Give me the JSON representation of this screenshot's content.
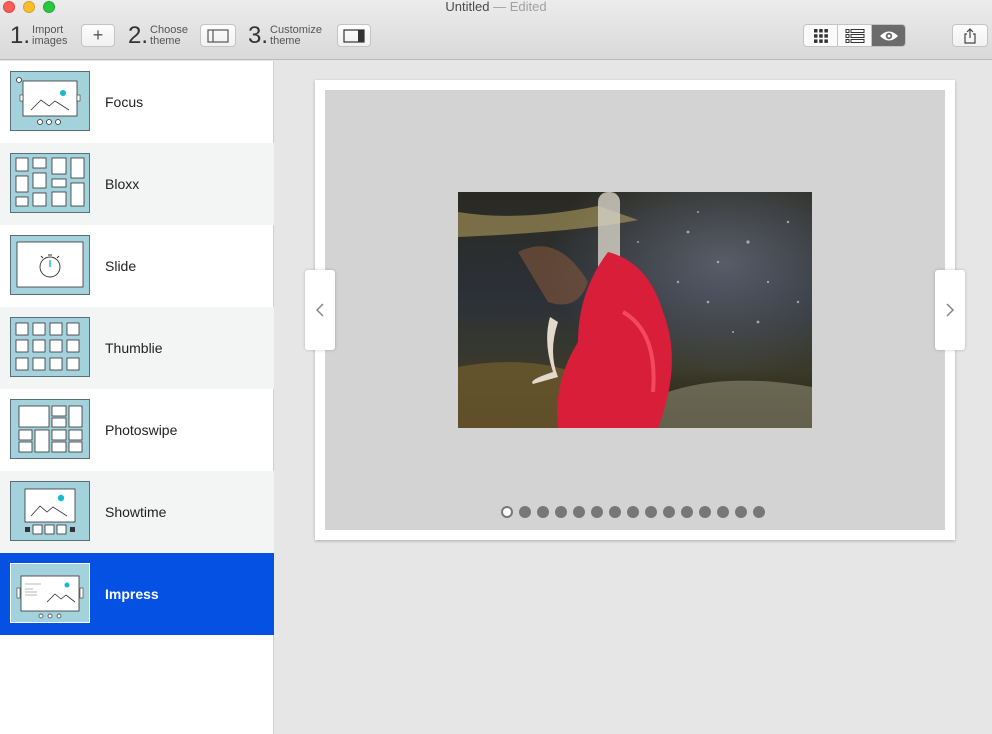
{
  "window": {
    "title": "Untitled",
    "status": "— Edited"
  },
  "toolbar": {
    "steps": [
      {
        "number": "1.",
        "line1": "Import",
        "line2": "images"
      },
      {
        "number": "2.",
        "line1": "Choose",
        "line2": "theme"
      },
      {
        "number": "3.",
        "line1": "Customize",
        "line2": "theme"
      }
    ],
    "add_button_label": "+"
  },
  "view_modes": [
    "grid-view-icon",
    "list-view-icon",
    "preview-eye-icon"
  ],
  "themes": [
    {
      "name": "Focus"
    },
    {
      "name": "Bloxx"
    },
    {
      "name": "Slide"
    },
    {
      "name": "Thumblie"
    },
    {
      "name": "Photoswipe"
    },
    {
      "name": "Showtime"
    },
    {
      "name": "Impress"
    }
  ],
  "selected_theme": "Impress",
  "preview": {
    "total_slides": 15,
    "current_slide": 1
  },
  "colors": {
    "accent": "#0551e3",
    "thumb_fill": "#a3d2dc",
    "thumb_accent": "#11bcd0"
  }
}
